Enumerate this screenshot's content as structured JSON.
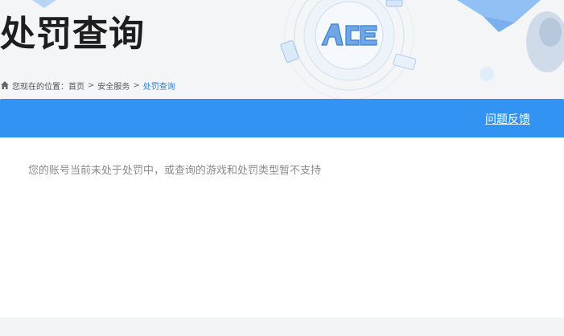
{
  "header": {
    "title": "处罚查询",
    "logo_text": "ACE",
    "breadcrumb": {
      "prefix": "您现在的位置：",
      "items": [
        "首页",
        "安全服务",
        "处罚查询"
      ],
      "separator": ">"
    }
  },
  "toolbar": {
    "feedback_label": "问题反馈"
  },
  "main": {
    "notice": "您的账号当前未处于处罚中，或查询的游戏和处罚类型暂不支持"
  },
  "colors": {
    "accent": "#3393f3",
    "link_current": "#2a7fd1"
  }
}
